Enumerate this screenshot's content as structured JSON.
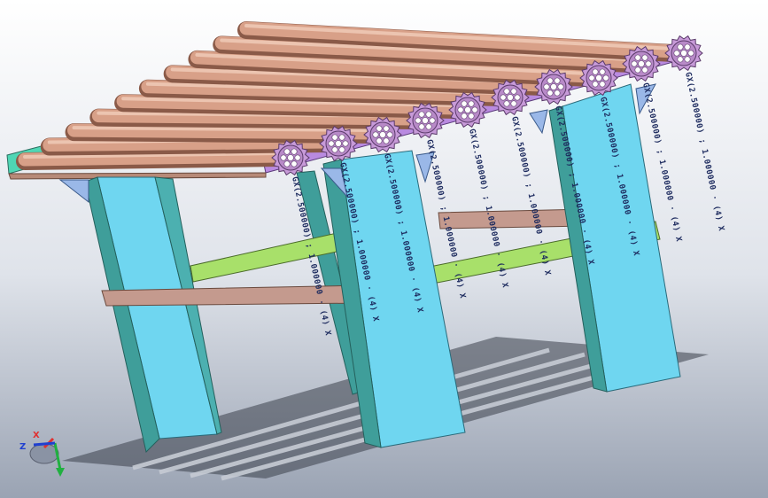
{
  "view": {
    "background_top": "#ffffff",
    "background_bottom": "#9aa3b3"
  },
  "colors": {
    "leg_face": "#6fd6f0",
    "leg_side": "#3f9e9a",
    "roller": "#d8a088",
    "roller_shadow": "#a06a58",
    "side_plate": "#4fd6b4",
    "purple_rail": "#b98ae0",
    "sprocket": "#c79ad8",
    "crossbar_green": "#a8e06a",
    "crossbar_pink": "#c49a8e",
    "bracket": "#9ab8e8",
    "annotation": "#1c2a5e"
  },
  "annotation_text": "GX(2.50000) ; 1.0000 : (4) X",
  "chain_annotations": [
    "GX(2.500000) ; 1.000000 · (4) X",
    "GX(2.500000) ; 1.000000 · (4) X",
    "GX(2.500000) ; 1.000000 · (4) X",
    "GX(2.500000) ; 1.000000 · (4) X",
    "GX(2.500000) ; 1.000000 · (4) X",
    "GX(2.500000) ; 1.000000 · (4) X",
    "GX(2.500000) ; 1.000000 · (4) X",
    "GX(2.500000) ; 1.000000 · (4) X",
    "GX(2.500000) ; 1.000000 · (4) X",
    "GX(2.500000) ; 1.000000 · (4) X"
  ],
  "triad": {
    "x_label": "X",
    "y_label": "Y",
    "z_label": "Z",
    "x_color": "#e03030",
    "y_color": "#20b040",
    "z_color": "#2040d0"
  }
}
